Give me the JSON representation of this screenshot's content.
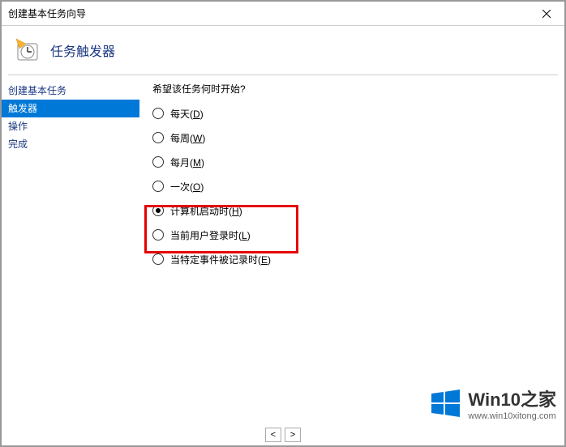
{
  "titlebar": {
    "title": "创建基本任务向导"
  },
  "header": {
    "title": "任务触发器"
  },
  "sidebar": {
    "items": [
      {
        "label": "创建基本任务",
        "selected": false
      },
      {
        "label": "触发器",
        "selected": true
      },
      {
        "label": "操作",
        "selected": false
      },
      {
        "label": "完成",
        "selected": false
      }
    ]
  },
  "main": {
    "prompt": "希望该任务何时开始?",
    "options": [
      {
        "label": "每天",
        "accel": "D",
        "checked": false
      },
      {
        "label": "每周",
        "accel": "W",
        "checked": false
      },
      {
        "label": "每月",
        "accel": "M",
        "checked": false
      },
      {
        "label": "一次",
        "accel": "O",
        "checked": false
      },
      {
        "label": "计算机启动时",
        "accel": "H",
        "checked": true
      },
      {
        "label": "当前用户登录时",
        "accel": "L",
        "checked": false
      },
      {
        "label": "当特定事件被记录时",
        "accel": "E",
        "checked": false
      }
    ]
  },
  "watermark": {
    "brand": "Win10之家",
    "url": "www.win10xitong.com"
  },
  "pager": {
    "prev": "<",
    "next": ">"
  }
}
